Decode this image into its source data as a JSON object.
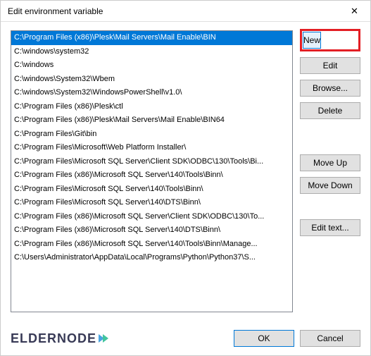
{
  "titlebar": {
    "title": "Edit environment variable"
  },
  "list": {
    "items": [
      "C:\\Program Files (x86)\\Plesk\\Mail Servers\\Mail Enable\\BIN",
      "C:\\windows\\system32",
      "C:\\windows",
      "C:\\windows\\System32\\Wbem",
      "C:\\windows\\System32\\WindowsPowerShell\\v1.0\\",
      "C:\\Program Files (x86)\\Plesk\\ctl",
      "C:\\Program Files (x86)\\Plesk\\Mail Servers\\Mail Enable\\BIN64",
      "C:\\Program Files\\Git\\bin",
      "C:\\Program Files\\Microsoft\\Web Platform Installer\\",
      "C:\\Program Files\\Microsoft SQL Server\\Client SDK\\ODBC\\130\\Tools\\Bi...",
      "C:\\Program Files (x86)\\Microsoft SQL Server\\140\\Tools\\Binn\\",
      "C:\\Program Files\\Microsoft SQL Server\\140\\Tools\\Binn\\",
      "C:\\Program Files\\Microsoft SQL Server\\140\\DTS\\Binn\\",
      "C:\\Program Files (x86)\\Microsoft SQL Server\\Client SDK\\ODBC\\130\\To...",
      "C:\\Program Files (x86)\\Microsoft SQL Server\\140\\DTS\\Binn\\",
      "C:\\Program Files (x86)\\Microsoft SQL Server\\140\\Tools\\Binn\\Manage...",
      "C:\\Users\\Administrator\\AppData\\Local\\Programs\\Python\\Python37\\S..."
    ],
    "selected_index": 0
  },
  "buttons": {
    "new": "New",
    "edit": "Edit",
    "browse": "Browse...",
    "delete": "Delete",
    "move_up": "Move Up",
    "move_down": "Move Down",
    "edit_text": "Edit text...",
    "ok": "OK",
    "cancel": "Cancel"
  },
  "logo": {
    "text": "ELDERNODE"
  }
}
